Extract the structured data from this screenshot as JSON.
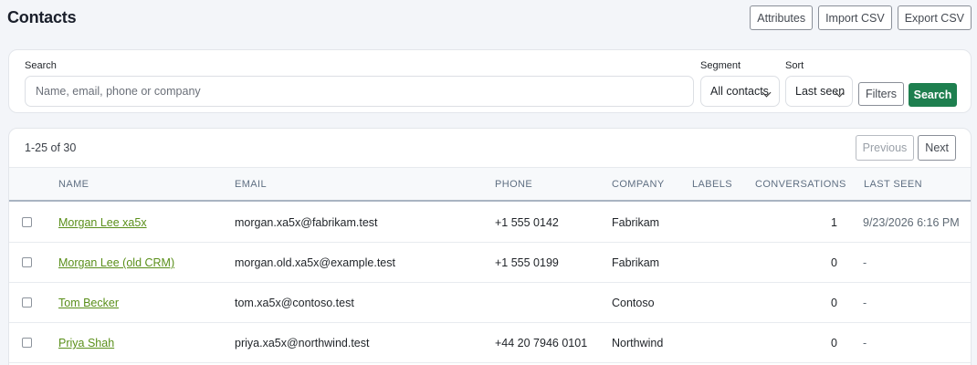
{
  "page": {
    "title": "Contacts"
  },
  "header_actions": [
    "Attributes",
    "Import CSV",
    "Export CSV"
  ],
  "filters": {
    "search_label": "Search",
    "search_placeholder": "Name, email, phone or company",
    "segment_label": "Segment",
    "segment_value": "All contacts",
    "sort_label": "Sort",
    "sort_value": "Last seen",
    "filters_button": "Filters",
    "search_button": "Search"
  },
  "table": {
    "range": "1-25 of 30",
    "previous": "Previous",
    "next": "Next",
    "columns": [
      "Name",
      "Email",
      "Phone",
      "Company",
      "Labels",
      "Conversations",
      "Last seen"
    ],
    "rows": [
      {
        "name": "Morgan Lee xa5x",
        "email": "morgan.xa5x@fabrikam.test",
        "phone": "+1 555 0142",
        "company": "Fabrikam",
        "labels": "",
        "conversations": "1",
        "last_seen": "9/23/2026 6:16 PM"
      },
      {
        "name": "Morgan Lee (old CRM)",
        "email": "morgan.old.xa5x@example.test",
        "phone": "+1 555 0199",
        "company": "Fabrikam",
        "labels": "",
        "conversations": "0",
        "last_seen": "-"
      },
      {
        "name": "Tom Becker",
        "email": "tom.xa5x@contoso.test",
        "phone": "",
        "company": "Contoso",
        "labels": "",
        "conversations": "0",
        "last_seen": "-"
      },
      {
        "name": "Priya Shah",
        "email": "priya.xa5x@northwind.test",
        "phone": "+44 20 7946 0101",
        "company": "Northwind",
        "labels": "",
        "conversations": "0",
        "last_seen": "-"
      }
    ]
  }
}
